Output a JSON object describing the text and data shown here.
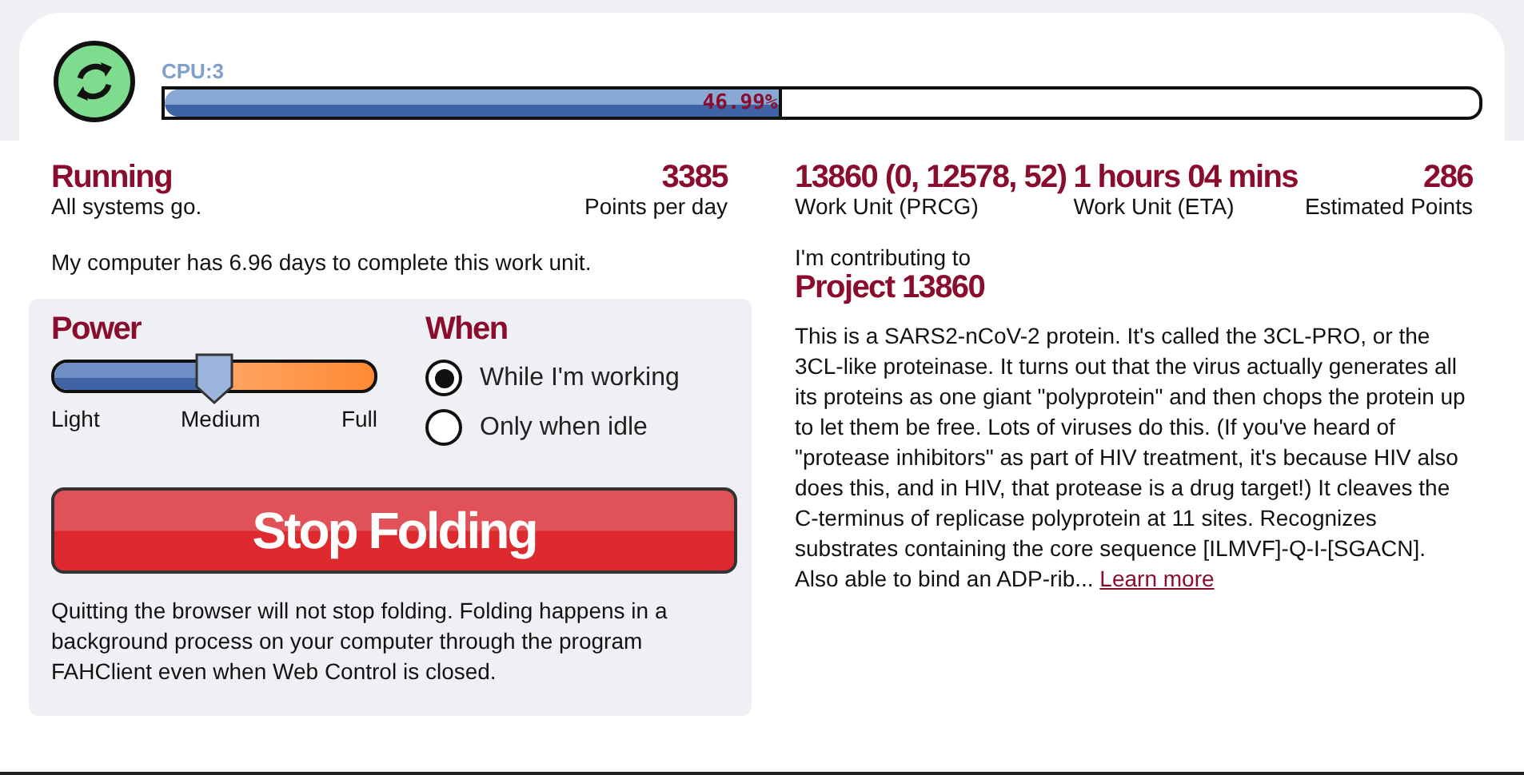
{
  "header": {
    "cpu_label": "CPU:3",
    "progress": {
      "level": 0.4699,
      "text": "46.99%"
    }
  },
  "status": {
    "title": "Running",
    "subtitle": "All systems go.",
    "points": "3385",
    "points_label": "Points per day"
  },
  "deadline": "My computer has 6.96 days to complete this work unit.",
  "power": {
    "title": "Power",
    "level": 0.5,
    "labels": [
      "Light",
      "Medium",
      "Full"
    ]
  },
  "when": {
    "title": "When",
    "options": [
      {
        "label": "While I'm working",
        "selected": true
      },
      {
        "label": "Only when idle",
        "selected": false
      }
    ]
  },
  "stop_button": "Stop Folding",
  "note": "Quitting the browser will not stop folding. Folding happens in a background process on your computer through the program FAHClient even when Web Control is closed.",
  "stats": [
    {
      "value": "13860 (0, 12578, 52)",
      "label": "Work Unit (PRCG)"
    },
    {
      "value": "1 hours 04 mins",
      "label": "Work Unit (ETA)"
    },
    {
      "value": "286",
      "label": "Estimated Points"
    }
  ],
  "contributing": "I'm contributing to",
  "project": "Project 13860",
  "description": "This is a SARS2-nCoV-2 protein. It's called the 3CL-PRO, or the 3CL-like proteinase. It turns out that the virus actually generates all its proteins as one giant \"polyprotein\" and then chops the protein up to let them be free. Lots of viruses do this. (If you've heard of \"protease inhibitors\" as part of HIV treatment, it's because HIV also does this, and in HIV, that protease is a drug target!) It cleaves the C-terminus of replicase polyprotein at 11 sites. Recognizes substrates containing the core sequence [ILMVF]-Q-I-[SGACN]. Also able to bind an ADP-rib...",
  "learn_more": "Learn more"
}
